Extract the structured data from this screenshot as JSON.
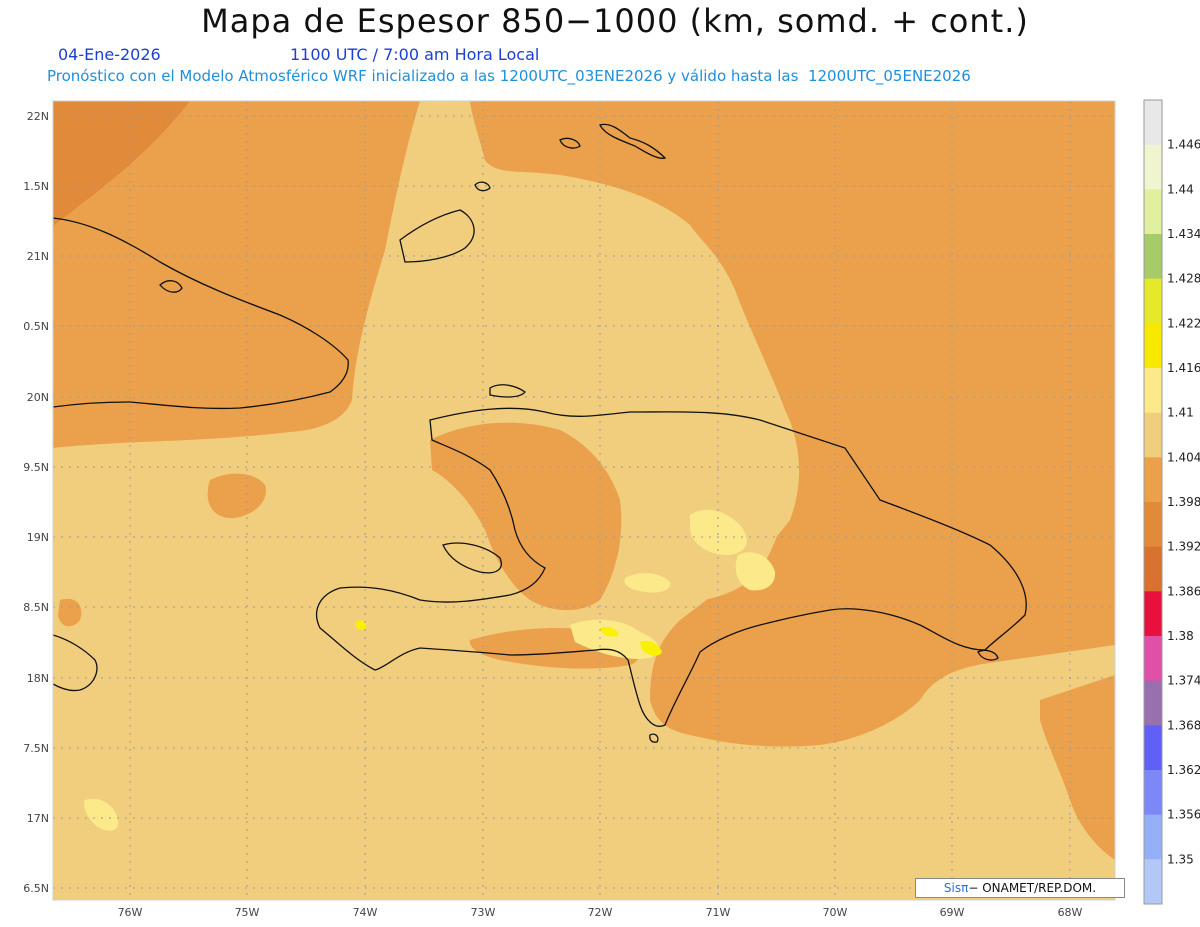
{
  "header": {
    "title": "Mapa de Espesor 850−1000 (km, somd. + cont.)",
    "date": "04-Ene-2026",
    "time": "1100 UTC / 7:00 am Hora Local",
    "description": "Pronóstico con el Modelo Atmosférico WRF inicializado a las 1200UTC_03ENE2026 y válido hasta las  1200UTC_05ENE2026"
  },
  "map": {
    "lat_labels": [
      "22N",
      "1.5N",
      "21N",
      "0.5N",
      "20N",
      "9.5N",
      "19N",
      "8.5N",
      "18N",
      "7.5N",
      "17N",
      "6.5N"
    ],
    "lon_labels": [
      "76W",
      "75W",
      "74W",
      "73W",
      "72W",
      "71W",
      "70W",
      "69W",
      "68W"
    ],
    "colors": {
      "dark_orange": "#e08a3a",
      "mid_orange": "#eba14c",
      "light_tan": "#f1ce7e",
      "pale_yellow": "#fbe98a",
      "yellow": "#f8f200",
      "coast": "#111111",
      "grid": "#9a9a9a"
    }
  },
  "colorbar": {
    "labels": [
      "1.446",
      "1.44",
      "1.434",
      "1.428",
      "1.422",
      "1.416",
      "1.41",
      "1.404",
      "1.398",
      "1.392",
      "1.386",
      "1.38",
      "1.374",
      "1.368",
      "1.362",
      "1.356",
      "1.35"
    ],
    "colors": [
      "#e8e8e8",
      "#f0f5d0",
      "#e0f0a0",
      "#a6cc6a",
      "#e6e82a",
      "#f8e800",
      "#fbe98a",
      "#f1ce7e",
      "#eba14c",
      "#e08a3a",
      "#d87230",
      "#e8103c",
      "#e050a8",
      "#9870b0",
      "#6060f8",
      "#7c88f8",
      "#96b0f8",
      "#b4c8f8"
    ]
  },
  "credit": {
    "sis": "Sis",
    "pi": "π",
    "text": "− ONAMET/REP.DOM."
  }
}
